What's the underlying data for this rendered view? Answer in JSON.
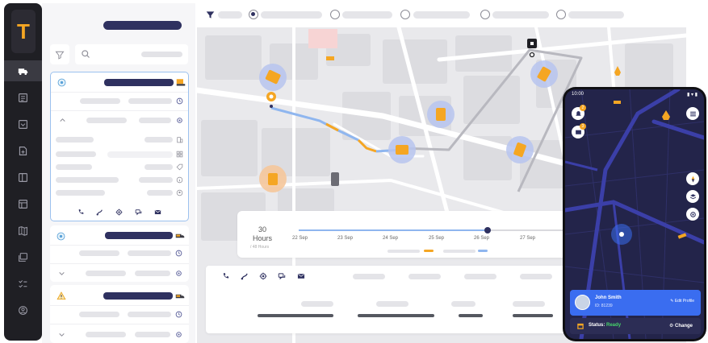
{
  "app": {
    "logo_letter": "T",
    "accent": "#F5A623",
    "brand": "#2F3160"
  },
  "sidebar": {
    "items": [
      {
        "icon": "truck-icon",
        "active": true
      },
      {
        "icon": "list-icon"
      },
      {
        "icon": "inbox-icon"
      },
      {
        "icon": "doc-add-icon"
      },
      {
        "icon": "book-icon"
      },
      {
        "icon": "layout-icon"
      },
      {
        "icon": "map-icon"
      },
      {
        "icon": "layers-icon"
      },
      {
        "icon": "checklist-icon"
      },
      {
        "icon": "user-circle-icon"
      }
    ]
  },
  "timeline": {
    "hours_value": "30",
    "hours_label": "Hours",
    "hours_sub": "/ 48 Hours",
    "dates": [
      "22 Sep",
      "23 Sep",
      "24 Sep",
      "25 Sep",
      "26 Sep",
      "27 Sep"
    ],
    "progress": 0.71
  },
  "phone": {
    "time": "10:00",
    "badges": [
      "2",
      "3"
    ],
    "driver": {
      "name": "John Smith",
      "id": "ID: 81239",
      "edit_label": "Edit Profile"
    },
    "status_label": "Status:",
    "status_value": "Ready",
    "change_label": "Change"
  }
}
